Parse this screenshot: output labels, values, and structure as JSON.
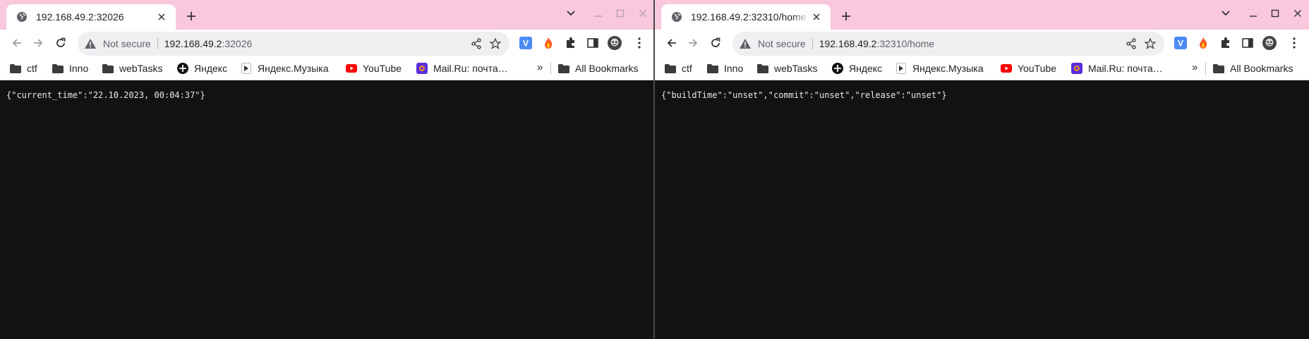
{
  "left": {
    "tab_title": "192.168.49.2:32026",
    "omnibox": {
      "security": "Not secure",
      "host": "192.168.49.2",
      "rest": ":32026"
    },
    "content": "{\"current_time\":\"22.10.2023, 00:04:37\"}"
  },
  "right": {
    "tab_title": "192.168.49.2:32310/home",
    "omnibox": {
      "security": "Not secure",
      "host": "192.168.49.2",
      "rest": ":32310/home"
    },
    "content": "{\"buildTime\":\"unset\",\"commit\":\"unset\",\"release\":\"unset\"}"
  },
  "bookmarks": [
    {
      "label": "ctf",
      "icon": "folder-icon"
    },
    {
      "label": "Inno",
      "icon": "folder-icon"
    },
    {
      "label": "webTasks",
      "icon": "folder-icon"
    },
    {
      "label": "Яндекс",
      "icon": "yandex-icon"
    },
    {
      "label": "Яндекс.Музыка",
      "icon": "play-icon"
    },
    {
      "label": "YouTube",
      "icon": "youtube-icon"
    },
    {
      "label": "Mail.Ru: почта…",
      "icon": "mailru-icon"
    }
  ],
  "bookmarks_more": "»",
  "all_bookmarks": "All Bookmarks",
  "extension_badge": "V",
  "colors": {
    "tabstrip": "#f9c8dc",
    "content_bg": "#121212",
    "youtube": "#ff0000",
    "mailru": "#5b2ede",
    "vext": "#4c8bf5"
  }
}
